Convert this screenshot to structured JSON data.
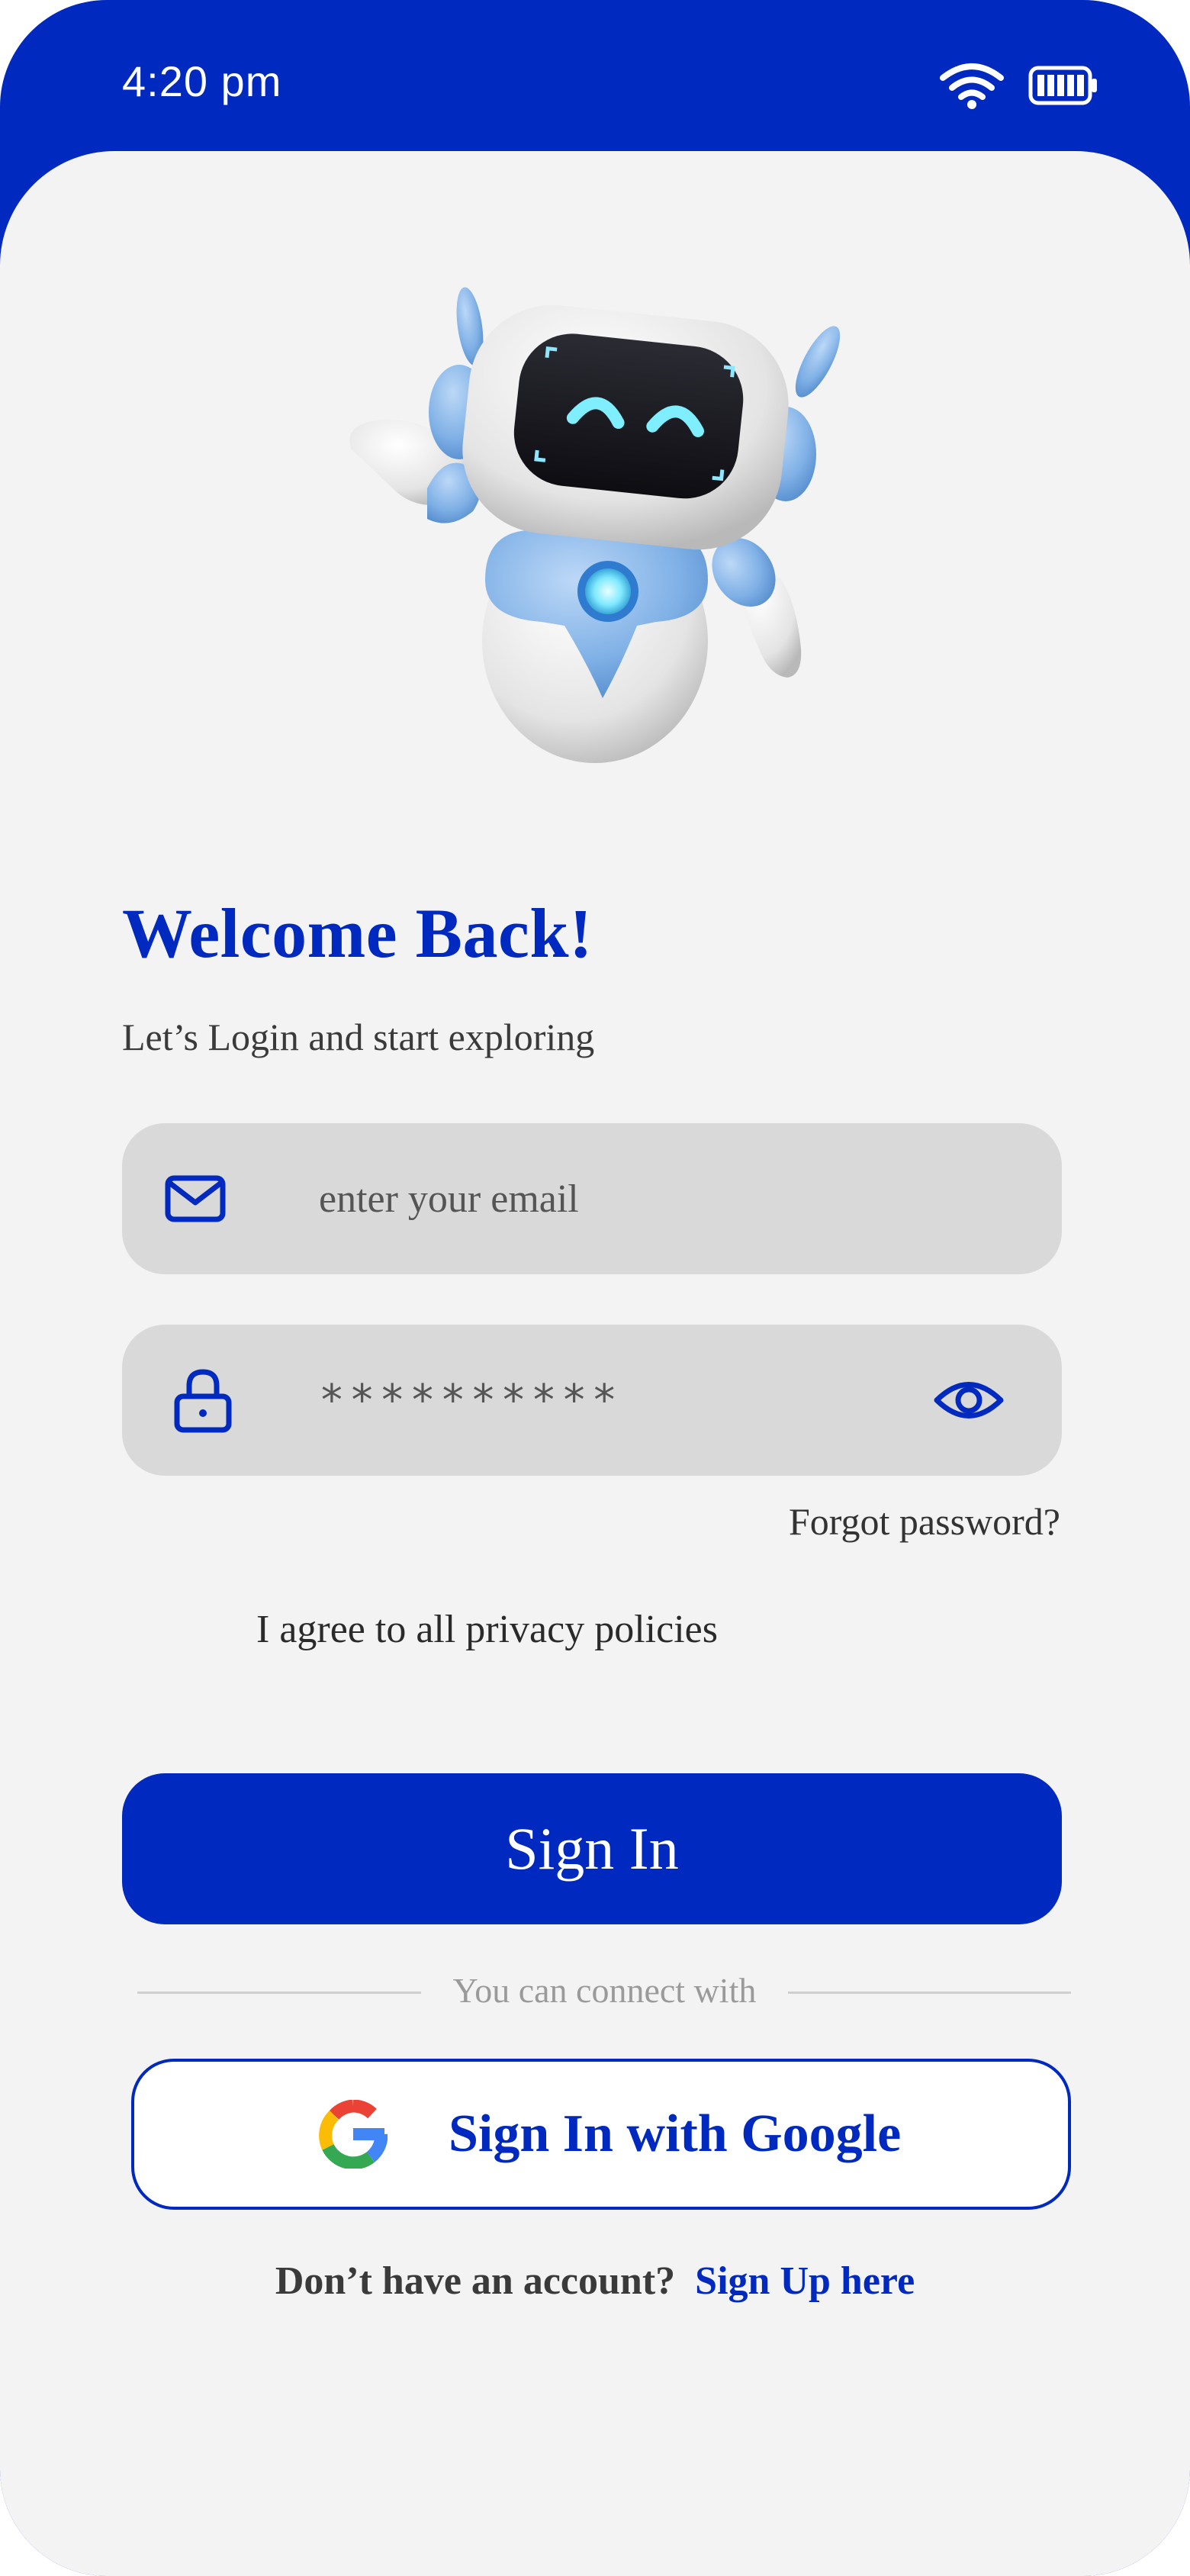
{
  "status_bar": {
    "time": "4:20 pm",
    "icons": [
      "wifi-icon",
      "battery-icon"
    ]
  },
  "hero": {
    "image": "waving-robot-illustration"
  },
  "header": {
    "title": "Welcome Back!",
    "subtitle": "Let’s Login and start exploring"
  },
  "form": {
    "email": {
      "icon": "envelope-icon",
      "placeholder": "enter your email",
      "value": ""
    },
    "password": {
      "icon": "lock-icon",
      "value": "**********",
      "toggle_icon": "eye-icon"
    },
    "forgot_password": "Forgot password?",
    "agree_label": "I agree to all privacy policies",
    "agree_checked": false,
    "sign_in_label": "Sign In"
  },
  "social": {
    "divider_text": "You can connect with",
    "google_label": "Sign In with Google",
    "google_icon": "google-logo-icon"
  },
  "footer": {
    "prompt": "Don’t have an account?",
    "link": "Sign Up here"
  },
  "colors": {
    "primary": "#0029BF",
    "background": "#F3F3F3",
    "field": "#D9D9D9"
  }
}
